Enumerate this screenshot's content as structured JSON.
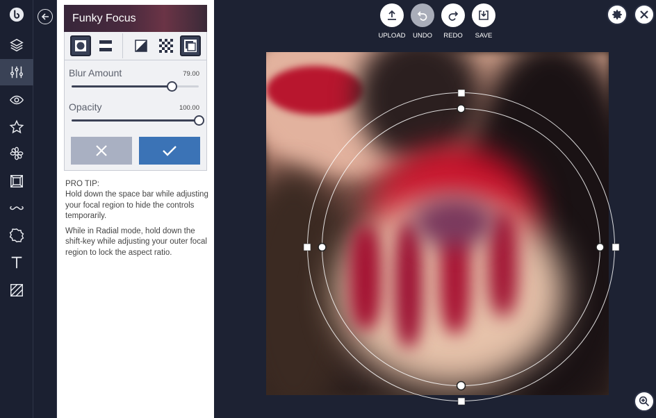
{
  "rail": {
    "items": [
      {
        "name": "logo-icon",
        "active": false
      },
      {
        "name": "layers-icon",
        "active": false
      },
      {
        "name": "adjustments-icon",
        "active": true
      },
      {
        "name": "eye-icon",
        "active": false
      },
      {
        "name": "star-icon",
        "active": false
      },
      {
        "name": "flower-icon",
        "active": false
      },
      {
        "name": "frame-icon",
        "active": false
      },
      {
        "name": "mustache-icon",
        "active": false
      },
      {
        "name": "badge-icon",
        "active": false
      },
      {
        "name": "text-icon",
        "active": false
      },
      {
        "name": "texture-icon",
        "active": false
      }
    ]
  },
  "panel": {
    "title": "Funky Focus",
    "modes": [
      {
        "name": "radial-mode",
        "selected": true
      },
      {
        "name": "linear-mode",
        "selected": false
      },
      {
        "name": "invert-mask-mode",
        "selected": false
      },
      {
        "name": "transparency-mode",
        "selected": false
      },
      {
        "name": "overlay-mode",
        "selected": true
      }
    ],
    "blur": {
      "label": "Blur Amount",
      "value": "79.00",
      "fraction": 0.79
    },
    "opacity": {
      "label": "Opacity",
      "value": "100.00",
      "fraction": 1.0
    }
  },
  "tip": {
    "heading": "PRO TIP:",
    "line1": "Hold down the space bar while adjusting your focal region to hide the controls temporarily.",
    "line2": "While in Radial mode, hold down the shift-key while adjusting your outer focal region to lock the aspect ratio."
  },
  "toolbar": {
    "upload": "UPLOAD",
    "undo": "UNDO",
    "redo": "REDO",
    "save": "SAVE"
  },
  "colors": {
    "background": "#1d2233",
    "accent": "#3b73b6",
    "cancel": "#a9b0c2"
  }
}
